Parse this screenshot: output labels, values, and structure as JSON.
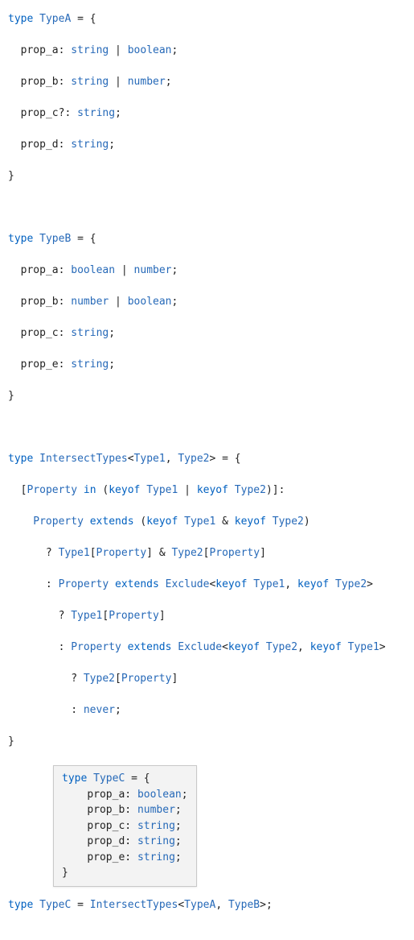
{
  "typeA": {
    "decl": {
      "kw": "type",
      "name": "TypeA",
      "eq": " = {"
    },
    "props": [
      {
        "name": "prop_a",
        "sep": ": ",
        "t1": "string",
        "bar": " | ",
        "t2": "boolean",
        "end": ";"
      },
      {
        "name": "prop_b",
        "sep": ": ",
        "t1": "string",
        "bar": " | ",
        "t2": "number",
        "end": ";"
      },
      {
        "name": "prop_c",
        "opt": "?",
        "sep": ": ",
        "t1": "string",
        "end": ";"
      },
      {
        "name": "prop_d",
        "sep": ": ",
        "t1": "string",
        "end": ";"
      }
    ],
    "close": "}"
  },
  "typeB": {
    "decl": {
      "kw": "type",
      "name": "TypeB",
      "eq": " = {"
    },
    "props": [
      {
        "name": "prop_a",
        "sep": ": ",
        "t1": "boolean",
        "bar": " | ",
        "t2": "number",
        "end": ";"
      },
      {
        "name": "prop_b",
        "sep": ": ",
        "t1": "number",
        "bar": " | ",
        "t2": "boolean",
        "end": ";"
      },
      {
        "name": "prop_c",
        "sep": ": ",
        "t1": "string",
        "end": ";"
      },
      {
        "name": "prop_e",
        "sep": ": ",
        "t1": "string",
        "end": ";"
      }
    ],
    "close": "}"
  },
  "intersect": {
    "decl": {
      "kw": "type",
      "name": "IntersectTypes",
      "lt": "<",
      "g1": "Type1",
      "comma": ", ",
      "g2": "Type2",
      "gt": ">",
      "eq": " = {"
    },
    "mapped": {
      "lb": "[",
      "prop": "Property",
      "in": " in ",
      "lp": "(",
      "keyof1": "keyof ",
      "t1": "Type1",
      "bar": " | ",
      "keyof2": "keyof ",
      "t2": "Type2",
      "rp": ")",
      "rb": "]",
      "colon": ":"
    },
    "cond1": {
      "prop": "Property",
      "extends": " extends ",
      "lp": "(",
      "keyof1": "keyof ",
      "t1": "Type1",
      "amp": " & ",
      "keyof2": "keyof ",
      "t2": "Type2",
      "rp": ")"
    },
    "res1": {
      "q": "? ",
      "t1": "Type1",
      "lb1": "[",
      "prop1": "Property",
      "rb1": "]",
      "amp": " & ",
      "t2": "Type2",
      "lb2": "[",
      "prop2": "Property",
      "rb2": "]"
    },
    "cond2": {
      "c": ": ",
      "prop": "Property",
      "extends": " extends ",
      "excl": "Exclude",
      "lt": "<",
      "keyof1": "keyof ",
      "t1": "Type1",
      "comma": ", ",
      "keyof2": "keyof ",
      "t2": "Type2",
      "gt": ">"
    },
    "res2": {
      "q": "? ",
      "t1": "Type1",
      "lb": "[",
      "prop": "Property",
      "rb": "]"
    },
    "cond3": {
      "c": ": ",
      "prop": "Property",
      "extends": " extends ",
      "excl": "Exclude",
      "lt": "<",
      "keyof1": "keyof ",
      "t1": "Type2",
      "comma": ", ",
      "keyof2": "keyof ",
      "t2": "Type1",
      "gt": ">"
    },
    "res3": {
      "q": "? ",
      "t1": "Type2",
      "lb": "[",
      "prop": "Property",
      "rb": "]"
    },
    "resNever": {
      "c": ": ",
      "never": "never",
      "end": ";"
    },
    "close": "}"
  },
  "tooltip": {
    "decl": {
      "kw": "type",
      "name": "TypeC",
      "eq": " = {"
    },
    "props": [
      {
        "name": "prop_a",
        "sep": ": ",
        "t": "boolean",
        "end": ";"
      },
      {
        "name": "prop_b",
        "sep": ": ",
        "t": "number",
        "end": ";"
      },
      {
        "name": "prop_c",
        "sep": ": ",
        "t": "string",
        "end": ";"
      },
      {
        "name": "prop_d",
        "sep": ": ",
        "t": "string",
        "end": ";"
      },
      {
        "name": "prop_e",
        "sep": ": ",
        "t": "string",
        "end": ";"
      }
    ],
    "close": "}"
  },
  "typeC": {
    "kw": "type",
    "name": "TypeC",
    "eq": " = ",
    "target": "IntersectTypes",
    "lt": "<",
    "a": "TypeA",
    "comma": ", ",
    "b": "TypeB",
    "gt": ">",
    "end": ";"
  }
}
